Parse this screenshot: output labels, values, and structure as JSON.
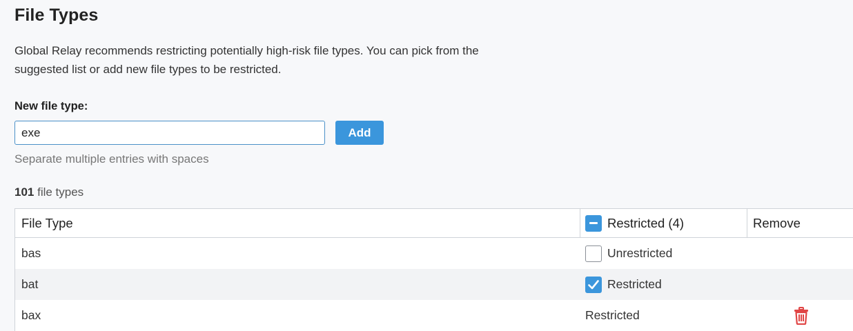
{
  "page": {
    "title": "File Types",
    "description": "Global Relay recommends restricting potentially high-risk file types. You can pick from the suggested list or add new file types to be restricted."
  },
  "form": {
    "label": "New file type:",
    "input_value": "exe",
    "add_label": "Add",
    "hint": "Separate multiple entries with spaces"
  },
  "summary": {
    "count": "101",
    "count_suffix": " file types"
  },
  "table": {
    "headers": {
      "file_type": "File Type",
      "restricted": "Restricted (4)",
      "remove": "Remove"
    },
    "rows": [
      {
        "file_type": "bas",
        "status": "Unrestricted",
        "control": "checkbox-unchecked",
        "removable": false
      },
      {
        "file_type": "bat",
        "status": "Restricted",
        "control": "checkbox-checked",
        "removable": false
      },
      {
        "file_type": "bax",
        "status": "Restricted",
        "control": "none",
        "removable": true
      }
    ]
  },
  "colors": {
    "accent": "#3b96dc",
    "delete": "#e04545",
    "border": "#cfd3d8",
    "background": "#f7f8fa"
  },
  "icons": {
    "header_toggle": "minus-checkbox-icon",
    "checked": "check-icon",
    "remove": "trash-icon"
  }
}
